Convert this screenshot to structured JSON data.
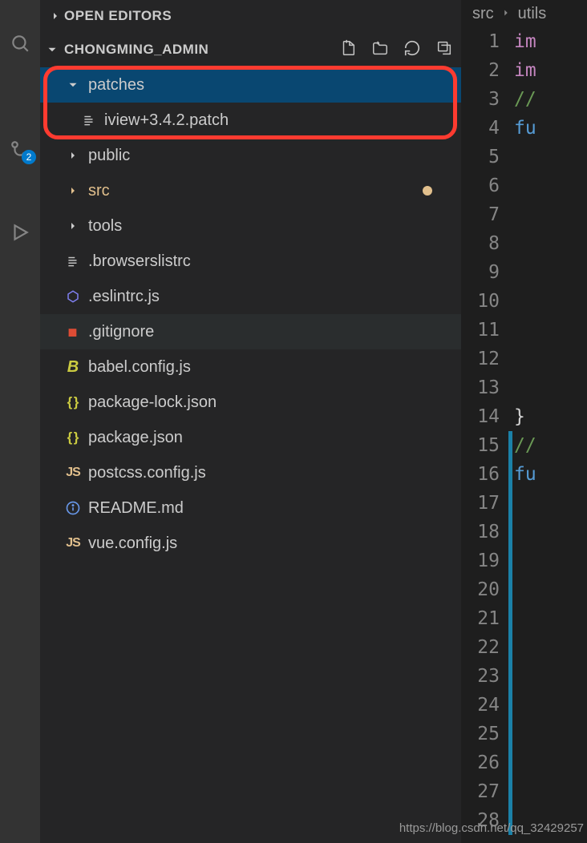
{
  "activity": {
    "badge": "2"
  },
  "sections": {
    "openEditors": "OPEN EDITORS",
    "project": "CHONGMING_ADMIN"
  },
  "tree": {
    "patches": "patches",
    "patchFile": "iview+3.4.2.patch",
    "public": "public",
    "src": "src",
    "tools": "tools",
    "browserslist": ".browserslistrc",
    "eslint": ".eslintrc.js",
    "gitignore": ".gitignore",
    "babel": "babel.config.js",
    "pkgLock": "package-lock.json",
    "pkg": "package.json",
    "postcss": "postcss.config.js",
    "readme": "README.md",
    "vueconfig": "vue.config.js"
  },
  "breadcrumbs": {
    "a": "src",
    "b": "utils"
  },
  "code": {
    "l1": "im",
    "l2": "im",
    "l3": "//",
    "l4": "fu",
    "l14": "}",
    "l15": "//",
    "l16": "fu"
  },
  "watermark": "https://blog.csdn.net/qq_32429257",
  "lineNumbers": [
    "1",
    "2",
    "3",
    "4",
    "5",
    "6",
    "7",
    "8",
    "9",
    "10",
    "11",
    "12",
    "13",
    "14",
    "15",
    "16",
    "17",
    "18",
    "19",
    "20",
    "21",
    "22",
    "23",
    "24",
    "25",
    "26",
    "27",
    "28"
  ]
}
